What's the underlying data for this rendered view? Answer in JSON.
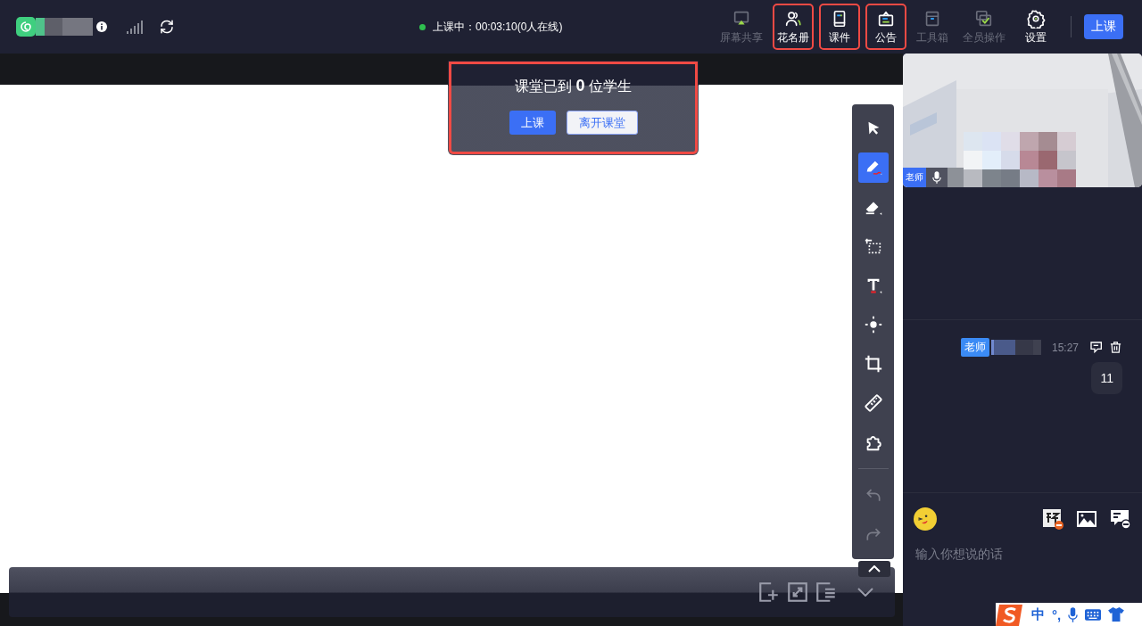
{
  "top_bar": {
    "status_text": "上课中：00:03:10(0人在线)",
    "online": true,
    "tools": [
      {
        "label": "屏幕共享",
        "disabled": true,
        "highlighted": false
      },
      {
        "label": "花名册",
        "disabled": false,
        "highlighted": true
      },
      {
        "label": "课件",
        "disabled": false,
        "highlighted": true
      },
      {
        "label": "公告",
        "disabled": false,
        "highlighted": true
      },
      {
        "label": "工具箱",
        "disabled": true,
        "highlighted": false
      },
      {
        "label": "全员操作",
        "disabled": true,
        "highlighted": false
      },
      {
        "label": "设置",
        "disabled": false,
        "highlighted": false
      }
    ],
    "start_button": "上课"
  },
  "attendance_popup": {
    "message": "课堂已到 **0** 位学生",
    "highlighted": true,
    "buttons": [
      {
        "label": "上课",
        "kind": "primary"
      },
      {
        "label": "离开课堂",
        "kind": "secondary"
      }
    ]
  },
  "draw_toolbar": {
    "tools": [
      {
        "selected": false
      },
      {
        "selected": true
      },
      {
        "selected": false
      },
      {
        "selected": false
      },
      {
        "selected": false
      },
      {
        "selected": false
      },
      {
        "selected": false
      },
      {
        "selected": false
      },
      {
        "selected": false
      }
    ],
    "history": [
      {
        "disabled": true
      },
      {
        "disabled": true
      }
    ]
  },
  "video": {
    "kind": "picture",
    "role_badge": "老师"
  },
  "chat": {
    "messages": [
      {
        "role": "老师",
        "time": "15:27",
        "text": "11"
      }
    ],
    "placeholder": "输入你想说的话"
  },
  "ime_bar": {
    "items": [
      "中",
      "°,"
    ]
  }
}
